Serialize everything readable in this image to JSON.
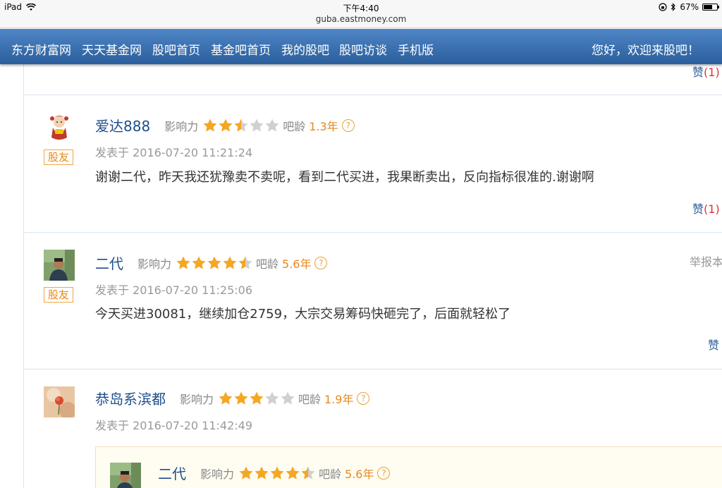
{
  "status_bar": {
    "device": "iPad",
    "time": "下午4:40",
    "url": "guba.eastmoney.com",
    "battery": "67%",
    "battery_level": 0.67
  },
  "nav": {
    "links": [
      "东方财富网",
      "天天基金网",
      "股吧首页",
      "基金吧首页",
      "我的股吧",
      "股吧访谈",
      "手机版"
    ],
    "greeting": "您好，欢迎来股吧！"
  },
  "top_like": {
    "label": "赞",
    "count": "(1)"
  },
  "posts": [
    {
      "username": "爱达888",
      "influence_label": "影响力",
      "stars": 2.5,
      "age_label": "吧龄",
      "age": "1.3年",
      "badge": "股友",
      "time": "发表于 2016-07-20 11:21:24",
      "text": "谢谢二代，昨天我还犹豫卖不卖呢，看到二代买进，我果断卖出，反向指标很准的.谢谢啊",
      "like_label": "赞",
      "like_count": "(1)"
    },
    {
      "username": "二代",
      "influence_label": "影响力",
      "stars": 4.5,
      "age_label": "吧龄",
      "age": "5.6年",
      "badge": "股友",
      "time": "发表于 2016-07-20 11:25:06",
      "text": "今天买进30081，继续加仓2759，大宗交易筹码快砸完了，后面就轻松了",
      "like_label": "赞",
      "report_label": "举报本"
    },
    {
      "username": "恭岛系滨都",
      "influence_label": "影响力",
      "stars": 3,
      "age_label": "吧龄",
      "age": "1.9年",
      "time": "发表于 2016-07-20 11:42:49",
      "quote": {
        "username": "二代",
        "influence_label": "影响力",
        "stars": 4.5,
        "age_label": "吧龄",
        "age": "5.6年"
      }
    }
  ],
  "colors": {
    "nav_top": "#4f86c6",
    "nav_bottom": "#2a5e9c",
    "username": "#1f4e8c",
    "star_on": "#f5a623",
    "star_off": "#d0d0d0",
    "accent_orange": "#e8891a"
  },
  "icons": [
    "wifi-icon",
    "lock-rotation-icon",
    "bluetooth-icon",
    "battery-icon",
    "question-icon",
    "star-icon"
  ]
}
